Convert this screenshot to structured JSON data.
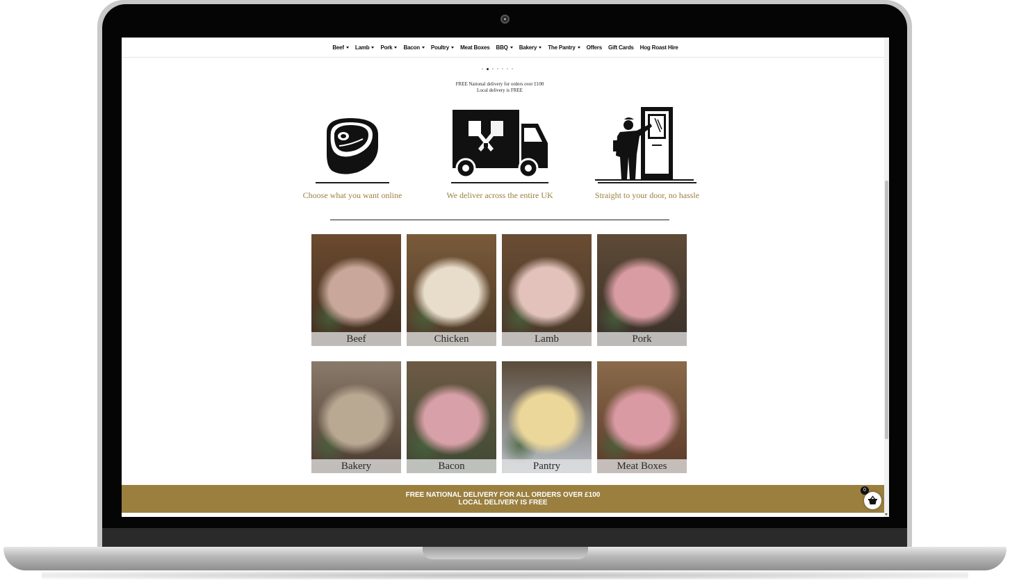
{
  "nav": {
    "items": [
      {
        "label": "Beef",
        "dropdown": true
      },
      {
        "label": "Lamb",
        "dropdown": true
      },
      {
        "label": "Pork",
        "dropdown": true
      },
      {
        "label": "Bacon",
        "dropdown": true
      },
      {
        "label": "Poultry",
        "dropdown": true
      },
      {
        "label": "Meat Boxes",
        "dropdown": false
      },
      {
        "label": "BBQ",
        "dropdown": true
      },
      {
        "label": "Bakery",
        "dropdown": true
      },
      {
        "label": "The Pantry",
        "dropdown": true
      },
      {
        "label": "Offers",
        "dropdown": false
      },
      {
        "label": "Gift Cards",
        "dropdown": false
      },
      {
        "label": "Hog Roast Hire",
        "dropdown": false
      }
    ]
  },
  "slider": {
    "slide_count": 7,
    "active_index": 1
  },
  "promo": {
    "line1": "FREE National delivery for orders over £100",
    "line2": "Local delivery is FREE"
  },
  "features": [
    {
      "icon": "steak-icon",
      "caption": "Choose what you want online"
    },
    {
      "icon": "delivery-truck-icon",
      "caption": "We deliver across the entire UK"
    },
    {
      "icon": "doorstep-delivery-icon",
      "caption": "Straight to your door, no hassle"
    }
  ],
  "categories": [
    {
      "label": "Beef",
      "colors": [
        "#6b4a2f",
        "#c9a79a",
        "#3f2f22"
      ]
    },
    {
      "label": "Chicken",
      "colors": [
        "#7a5a3a",
        "#e8dccb",
        "#4b3a28"
      ]
    },
    {
      "label": "Lamb",
      "colors": [
        "#6a4c33",
        "#e2c2bb",
        "#47382a"
      ]
    },
    {
      "label": "Pork",
      "colors": [
        "#5e4a37",
        "#d89ca2",
        "#39302a"
      ]
    },
    {
      "label": "Bakery",
      "colors": [
        "#8a7a6a",
        "#b9a892",
        "#4a3a2e"
      ]
    },
    {
      "label": "Bacon",
      "colors": [
        "#6e5a44",
        "#d8a0a8",
        "#3e4a34"
      ]
    },
    {
      "label": "Pantry",
      "colors": [
        "#5a4a3a",
        "#ecd79a",
        "#b8c0c8"
      ]
    },
    {
      "label": "Meat Boxes",
      "colors": [
        "#8a6a4a",
        "#d99aa4",
        "#5a3a2a"
      ]
    }
  ],
  "banner": {
    "line1": "FREE NATIONAL DELIVERY FOR ALL ORDERS OVER £100",
    "line2": "LOCAL DELIVERY IS FREE"
  },
  "cart": {
    "count": "0",
    "icon": "basket-icon"
  },
  "colors": {
    "gold": "#9a7f3f",
    "caption_gold": "#9b7f3e"
  }
}
